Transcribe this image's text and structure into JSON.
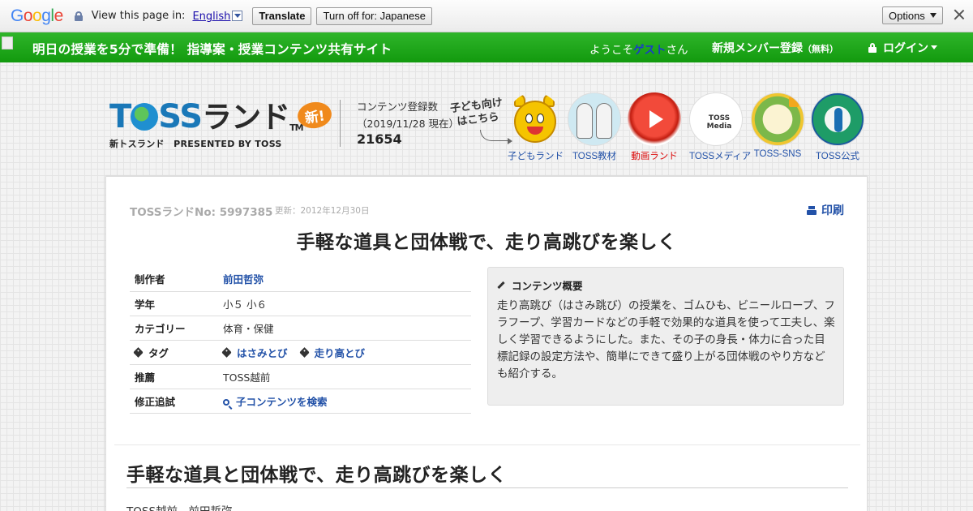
{
  "translate_bar": {
    "logo": "Google",
    "prompt": "View this page in:",
    "language": "English",
    "translate_label": "Translate",
    "turn_off_label": "Turn off for: Japanese",
    "options_label": "Options"
  },
  "navbar": {
    "site_title": "明日の授業を5分で準備！ 指導案・授業コンテンツ共有サイト",
    "welcome_prefix": "ようこそ",
    "welcome_user": "ゲスト",
    "welcome_suffix": "さん",
    "register_label": "新規メンバー登録",
    "register_note": "（無料）",
    "login_label": "ログイン"
  },
  "header": {
    "logo_word_t": "T",
    "logo_word_ss": "SS",
    "logo_land": "ランド",
    "logo_tm": "TM",
    "logo_badge": "新!",
    "logo_sub": "新トスランド　PRESENTED BY TOSS",
    "count_label": "コンテンツ登録数",
    "count_date": "（2019/11/28 現在）",
    "count_value": "21654",
    "kids_callout_line1": "子ども向け",
    "kids_callout_line2": "はこちら",
    "media_badge_text": "TOSS Media",
    "nav_icons": [
      {
        "label": "子どもランド",
        "icon": "mascot-icon"
      },
      {
        "label": "TOSS教材",
        "icon": "kyozai-icon"
      },
      {
        "label": "動画ランド",
        "icon": "play-icon"
      },
      {
        "label": "TOSSメディア",
        "icon": "media-icon"
      },
      {
        "label": "TOSS-SNS",
        "icon": "sns-icon"
      },
      {
        "label": "TOSS公式",
        "icon": "official-icon"
      }
    ]
  },
  "content": {
    "number": "TOSSランドNo: 5997385",
    "updated": "更新：2012年12月30日",
    "print_label": "印刷",
    "title": "手軽な道具と団体戦で、走り高跳びを楽しく",
    "info": {
      "author_key": "制作者",
      "author_value": "前田哲弥",
      "grade_key": "学年",
      "grade_value": "小５ 小６",
      "category_key": "カテゴリー",
      "category_value": "体育・保健",
      "tag_key": "タグ",
      "tags": [
        "はさみとび",
        "走り高とび"
      ],
      "recommend_key": "推薦",
      "recommend_value": "TOSS越前",
      "revision_key": "修正追試",
      "revision_value": "子コンテンツを検索"
    },
    "summary_heading": "コンテンツ概要",
    "summary_text": "走り高跳び（はさみ跳び）の授業を、ゴムひも、ビニールロープ、フラフープ、学習カードなどの手軽で効果的な道具を使って工夫し、楽しく学習できるようにした。また、その子の身長・体力に合った目標記録の設定方法や、簡単にできて盛り上がる団体戦のやり方なども紹介する。",
    "body_title": "手軽な道具と団体戦で、走り高跳びを楽しく",
    "body_author": "TOSS越前　前田哲弥"
  }
}
